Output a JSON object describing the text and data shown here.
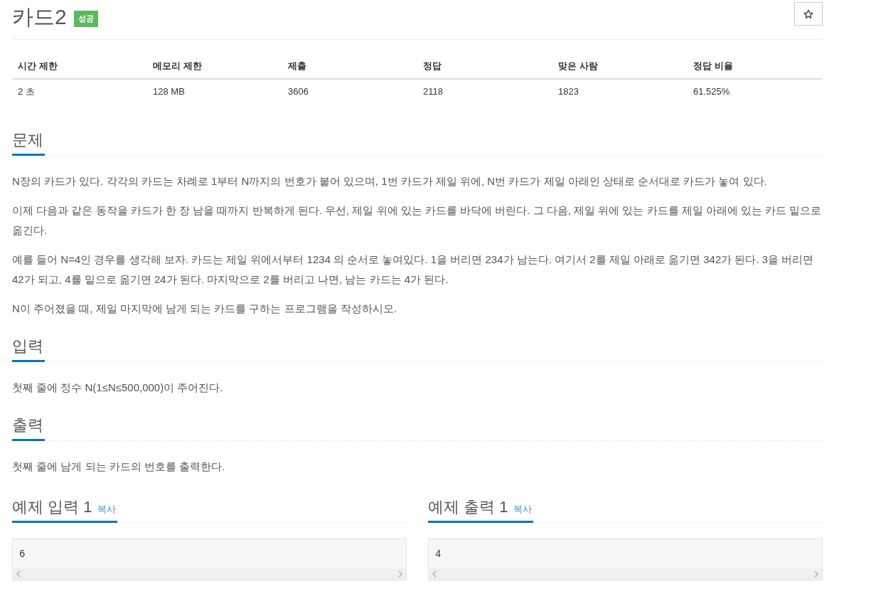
{
  "problem": {
    "title": "카드2",
    "badge": "성공"
  },
  "info_table": {
    "columns": [
      "시간 제한",
      "메모리 제한",
      "제출",
      "정답",
      "맞은 사람",
      "정답 비율"
    ],
    "rows": [
      [
        "2 초",
        "128 MB",
        "3606",
        "2118",
        "1823",
        "61.525%"
      ]
    ]
  },
  "sections": [
    {
      "heading": "문제",
      "paragraphs": [
        "N장의 카드가 있다. 각각의 카드는 차례로 1부터 N까지의 번호가 붙어 있으며, 1번 카드가 제일 위에, N번 카드가 제일 아래인 상태로 순서대로 카드가 놓여 있다.",
        "이제 다음과 같은 동작을 카드가 한 장 남을 때까지 반복하게 된다. 우선, 제일 위에 있는 카드를 바닥에 버린다. 그 다음, 제일 위에 있는 카드를 제일 아래에 있는 카드 밑으로 옮긴다.",
        "예를 들어 N=4인 경우를 생각해 보자. 카드는 제일 위에서부터 1234 의 순서로 놓여있다. 1을 버리면 234가 남는다. 여기서 2를 제일 아래로 옮기면 342가 된다. 3을 버리면 42가 되고, 4를 밑으로 옮기면 24가 된다. 마지막으로 2를 버리고 나면, 남는 카드는 4가 된다.",
        "N이 주어졌을 때, 제일 마지막에 남게 되는 카드를 구하는 프로그램을 작성하시오."
      ]
    },
    {
      "heading": "입력",
      "paragraphs": [
        "첫째 줄에 정수 N(1≤N≤500,000)이 주어진다."
      ]
    },
    {
      "heading": "출력",
      "paragraphs": [
        "첫째 줄에 남게 되는 카드의 번호를 출력한다."
      ]
    }
  ],
  "samples": [
    {
      "heading": "예제 입력 1",
      "copy_link": "복사",
      "content": "6"
    },
    {
      "heading": "예제 출력 1",
      "copy_link": "복사",
      "content": "4"
    }
  ]
}
